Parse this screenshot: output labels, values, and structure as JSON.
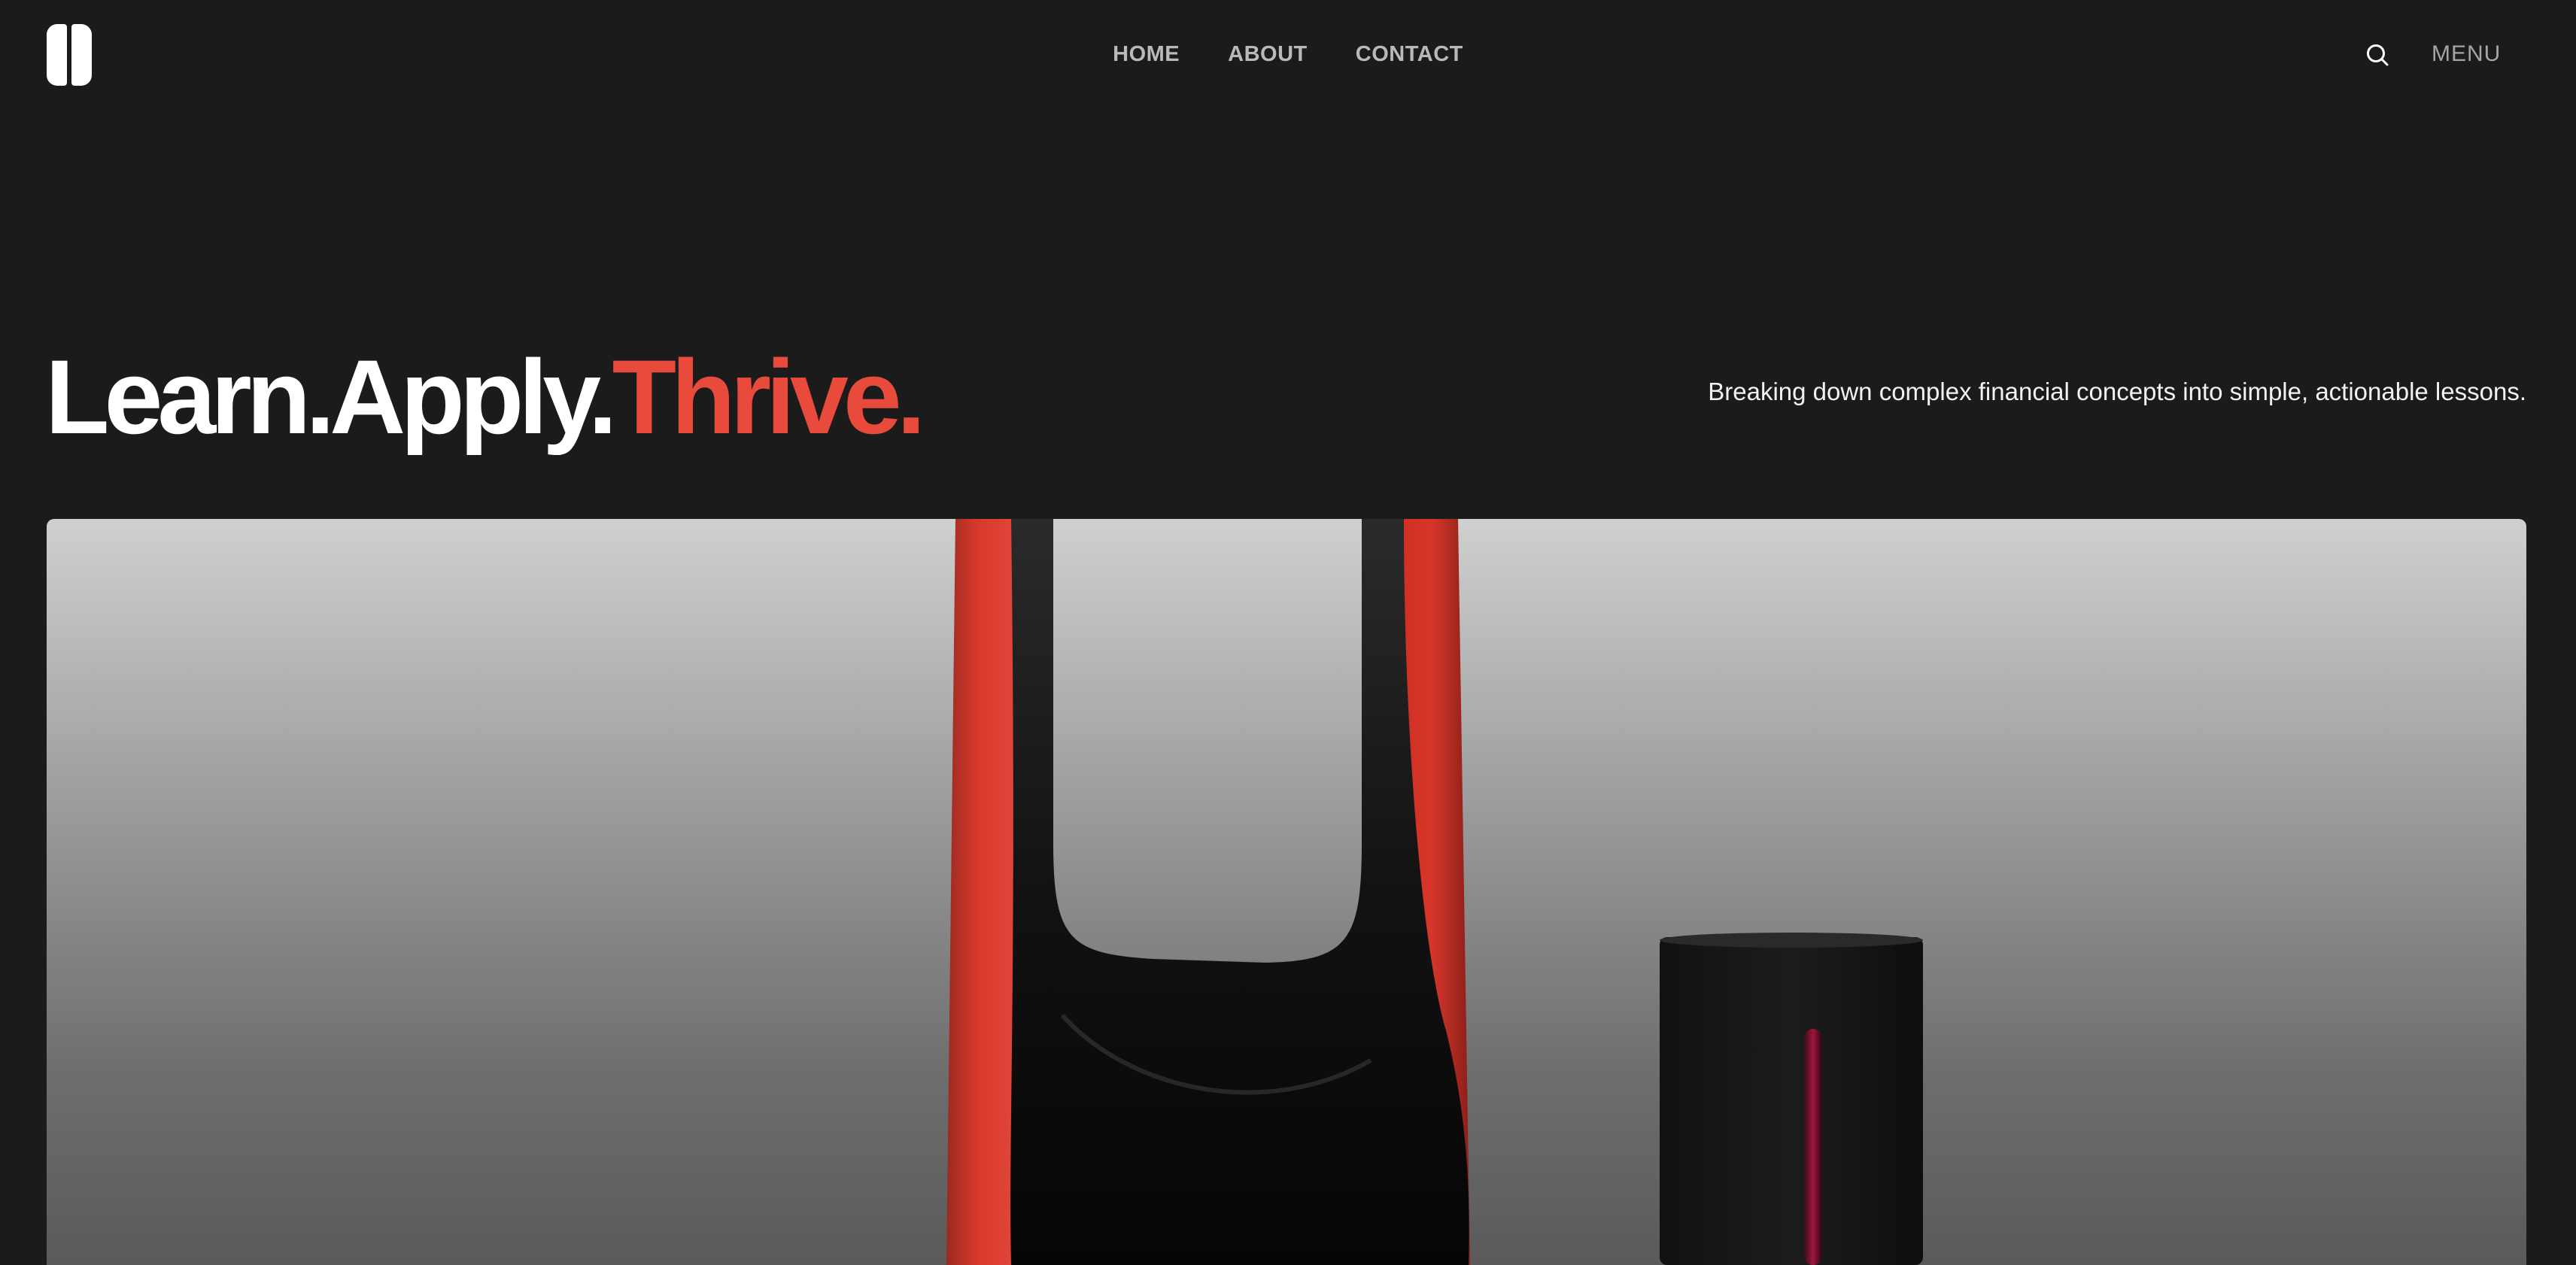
{
  "header": {
    "logo_icon": "pause-bars-logo-icon",
    "nav": [
      {
        "label": "HOME"
      },
      {
        "label": "ABOUT"
      },
      {
        "label": "CONTACT"
      }
    ],
    "search_icon": "search-icon",
    "menu_label": "MENU"
  },
  "hero": {
    "headline": {
      "part1": "Learn.Apply.",
      "part2": "Thrive."
    },
    "tagline": "Breaking down complex financial concepts into simple, actionable lessons.",
    "image_subject": "red and black sculpted objects on grey gradient backdrop"
  },
  "colors": {
    "background": "#1b1b1b",
    "accent": "#e84a3c",
    "nav_text": "#b9b9b9"
  }
}
